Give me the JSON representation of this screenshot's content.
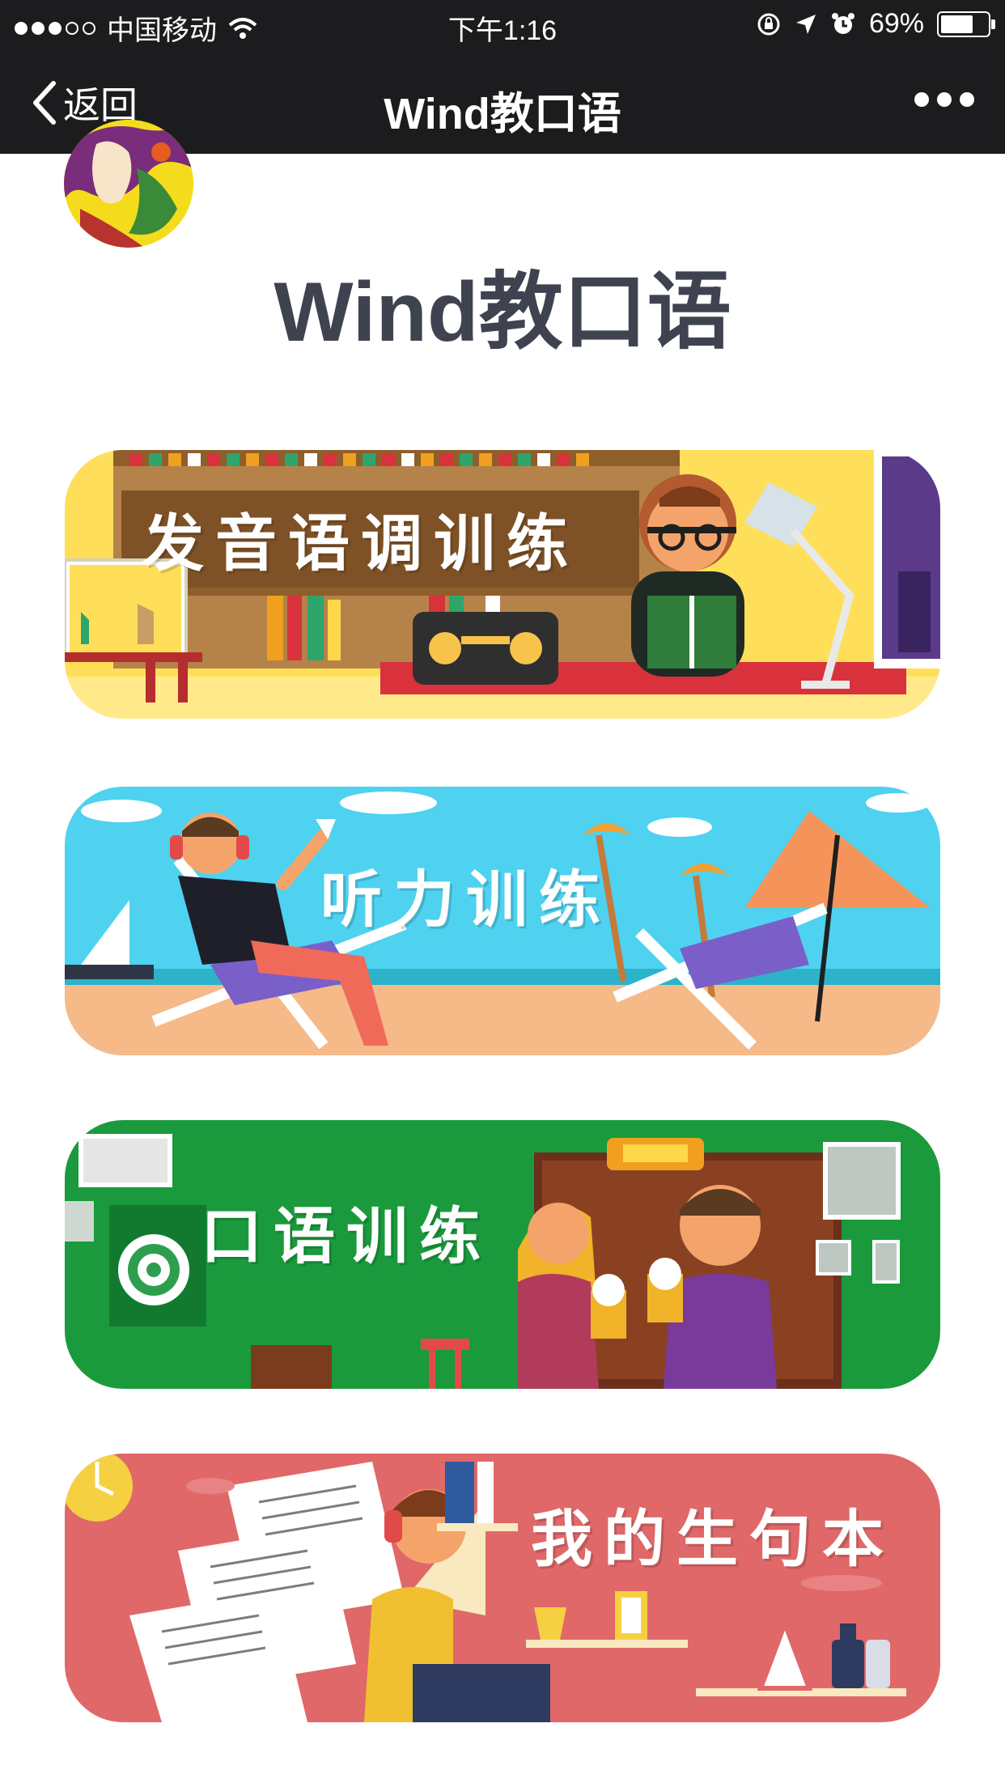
{
  "status_bar": {
    "carrier": "中国移动",
    "time": "下午1:16",
    "battery": "69%",
    "battery_level": 0.69
  },
  "nav": {
    "back_label": "返回",
    "title": "Wind教口语"
  },
  "header": {
    "title": "Wind教口语"
  },
  "banners": [
    {
      "label": "发音语调训练",
      "theme": "library",
      "colors": {
        "bg": "#ffd84a",
        "accent": "#d9323c"
      }
    },
    {
      "label": "听力训练",
      "theme": "beach",
      "colors": {
        "bg": "#4fd0ef",
        "accent": "#f4b884"
      }
    },
    {
      "label": "口语训练",
      "theme": "pub",
      "colors": {
        "bg": "#1a9a3c",
        "accent": "#7a3b1e"
      }
    },
    {
      "label": "我的生句本",
      "theme": "study",
      "colors": {
        "bg": "#e06868",
        "accent": "#f5d142"
      }
    }
  ]
}
